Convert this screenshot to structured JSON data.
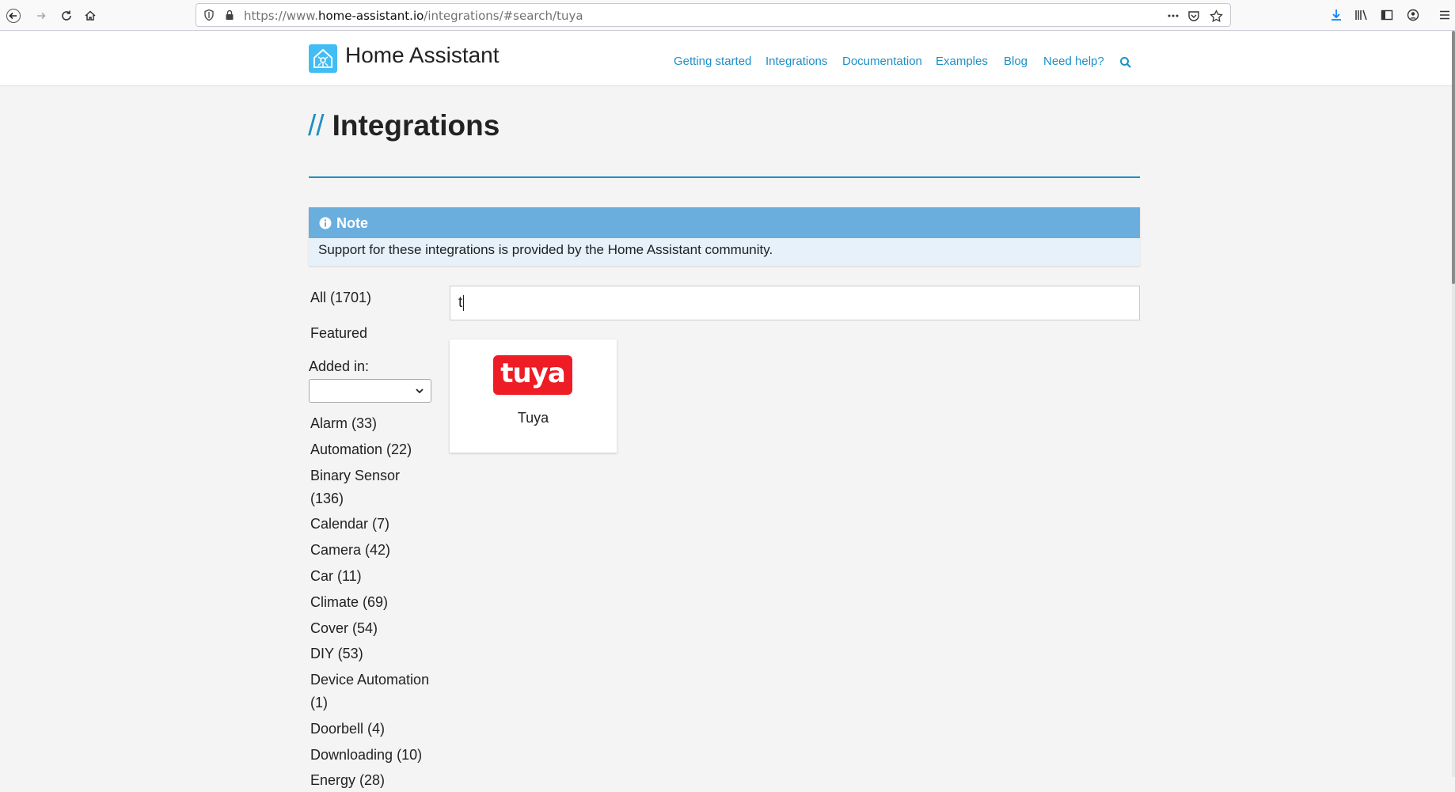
{
  "browser": {
    "url_prefix": "https://www.",
    "url_host": "home-assistant.io",
    "url_path": "/integrations/#search/tuya"
  },
  "header": {
    "site_name": "Home Assistant",
    "nav": [
      "Getting started",
      "Integrations",
      "Documentation",
      "Examples",
      "Blog",
      "Need help?"
    ]
  },
  "page": {
    "title_prefix": "//",
    "title": "Integrations"
  },
  "note": {
    "title": "Note",
    "body": "Support for these integrations is provided by the Home Assistant community."
  },
  "sidebar": {
    "all": "All (1701)",
    "featured": "Featured",
    "added_in_label": "Added in:",
    "added_in_value": "",
    "categories": [
      "Alarm (33)",
      "Automation (22)",
      "Binary Sensor (136)",
      "Calendar (7)",
      "Camera (42)",
      "Car (11)",
      "Climate (69)",
      "Cover (54)",
      "DIY (53)",
      "Device Automation (1)",
      "Doorbell (4)",
      "Downloading (10)",
      "Energy (28)"
    ]
  },
  "search": {
    "value": "t"
  },
  "results": [
    {
      "logo_text": "tuya",
      "name": "Tuya"
    }
  ],
  "colors": {
    "accent": "#1e8fc6",
    "note_header": "#6aaede",
    "tuya_red": "#ee1c25"
  }
}
